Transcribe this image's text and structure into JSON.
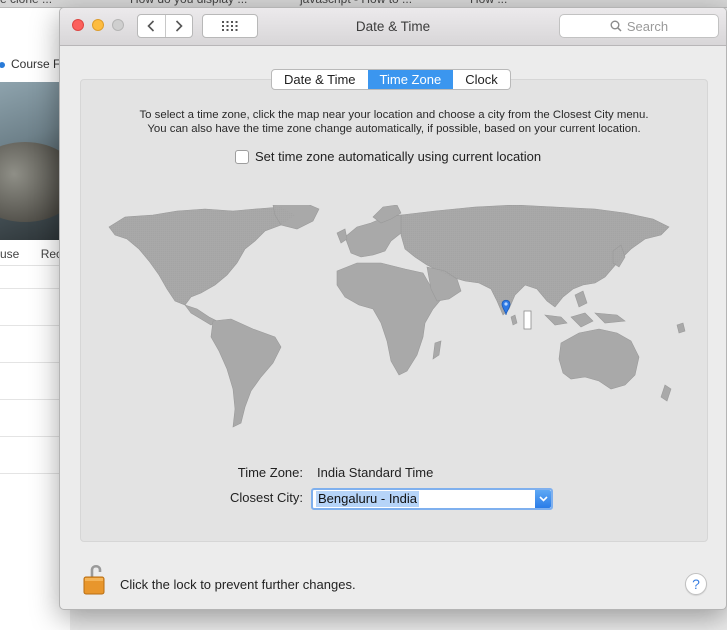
{
  "browser": {
    "tabs": [
      "e clone ...",
      "How do you display ...",
      "javascript - How to ...",
      "How ..."
    ],
    "course_link": "Course F",
    "course_tabs": [
      "use",
      "Rec"
    ]
  },
  "window": {
    "title": "Date & Time",
    "search_placeholder": "Search"
  },
  "tabs": [
    {
      "label": "Date & Time",
      "active": false
    },
    {
      "label": "Time Zone",
      "active": true
    },
    {
      "label": "Clock",
      "active": false
    }
  ],
  "timezone": {
    "info_line1": "To select a time zone, click the map near your location and choose a city from the Closest City menu.",
    "info_line2": "You can also have the time zone change automatically, if possible, based on your current location.",
    "auto_label": "Set time zone automatically using current location",
    "auto_checked": false,
    "zone_label": "Time Zone:",
    "zone_value": "India Standard Time",
    "city_label": "Closest City:",
    "city_value": "Bengaluru - India"
  },
  "lock": {
    "text": "Click the lock to prevent further changes.",
    "state": "unlocked"
  },
  "help_label": "?",
  "colors": {
    "accent": "#3b96ef",
    "map_land": "#a8a8a8",
    "pin": "#2f7ae5"
  }
}
